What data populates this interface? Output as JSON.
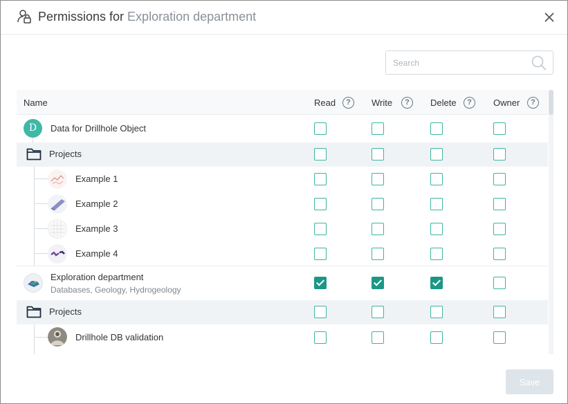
{
  "header": {
    "title_prefix": "Permissions for ",
    "title_subject": "Exploration department"
  },
  "search": {
    "placeholder": "Search"
  },
  "table": {
    "columns": {
      "name": "Name",
      "read": "Read",
      "write": "Write",
      "delete": "Delete",
      "owner": "Owner"
    },
    "help_glyph": "?",
    "rows": [
      {
        "label": "Data for Drillhole Object",
        "avatar_letter": "D",
        "read": false,
        "write": false,
        "delete": false,
        "owner": false
      },
      {
        "label": "Projects",
        "icon": "folder-icon",
        "read": false,
        "write": false,
        "delete": false,
        "owner": false
      },
      {
        "label": "Example 1",
        "read": false,
        "write": false,
        "delete": false,
        "owner": false
      },
      {
        "label": "Example 2",
        "read": false,
        "write": false,
        "delete": false,
        "owner": false
      },
      {
        "label": "Example 3",
        "read": false,
        "write": false,
        "delete": false,
        "owner": false
      },
      {
        "label": "Example 4",
        "read": false,
        "write": false,
        "delete": false,
        "owner": false
      },
      {
        "label": "Exploration department",
        "sublabel": "Databases, Geology, Hydrogeology",
        "read": true,
        "write": true,
        "delete": true,
        "owner": false
      },
      {
        "label": "Projects",
        "icon": "folder-icon",
        "read": false,
        "write": false,
        "delete": false,
        "owner": false
      },
      {
        "label": "Drillhole DB validation",
        "read": false,
        "write": false,
        "delete": false,
        "owner": false
      }
    ]
  },
  "footer": {
    "save_label": "Save"
  },
  "colors": {
    "accent": "#1c9787",
    "checkbox_border": "#3cb4a0",
    "avatar": "#3fb8a6"
  }
}
